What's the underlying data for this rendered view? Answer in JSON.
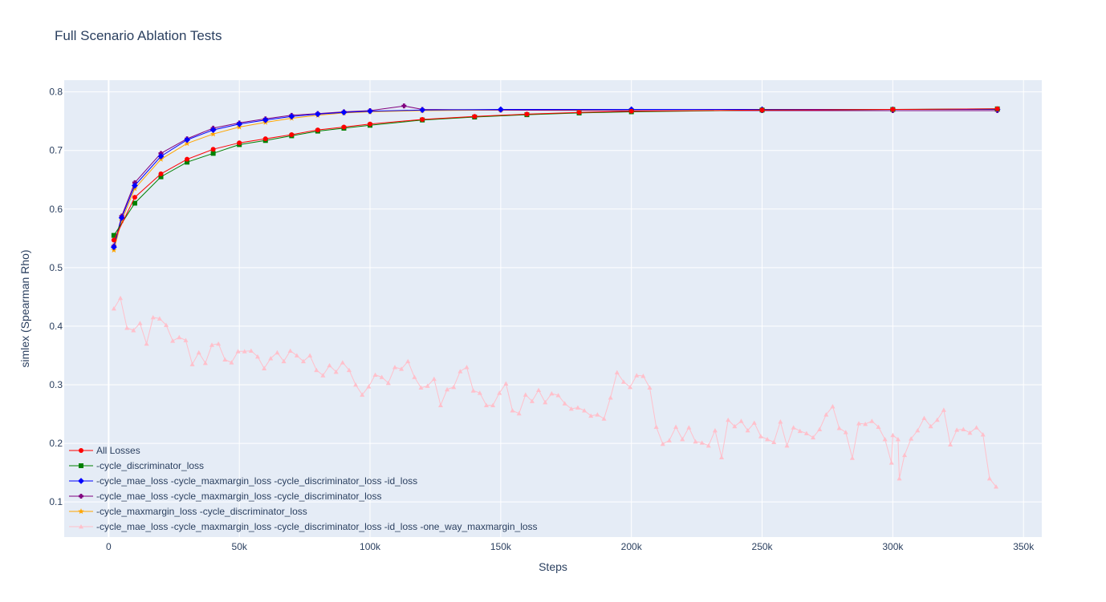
{
  "chart_data": {
    "type": "line",
    "title": "Full Scenario Ablation Tests",
    "xlabel": "Steps",
    "ylabel": "simlex (Spearman Rho)",
    "xlim": [
      -17000,
      357000
    ],
    "ylim": [
      0.04,
      0.82
    ],
    "x_ticks": [
      0,
      50000,
      100000,
      150000,
      200000,
      250000,
      300000,
      350000
    ],
    "x_tick_labels": [
      "0",
      "50k",
      "100k",
      "150k",
      "200k",
      "250k",
      "300k",
      "350k"
    ],
    "y_ticks": [
      0.1,
      0.2,
      0.3,
      0.4,
      0.5,
      0.6,
      0.7,
      0.8
    ],
    "y_tick_labels": [
      "0.1",
      "0.2",
      "0.3",
      "0.4",
      "0.5",
      "0.6",
      "0.7",
      "0.8"
    ],
    "grid": true,
    "legend_position": "bottom-left",
    "background_color": "#e5ecf6",
    "series": [
      {
        "name": "All Losses",
        "color": "#ff0000",
        "marker": "circle",
        "points": [
          [
            2000,
            0.547
          ],
          [
            10000,
            0.62
          ],
          [
            20000,
            0.66
          ],
          [
            30000,
            0.685
          ],
          [
            40000,
            0.702
          ],
          [
            50000,
            0.713
          ],
          [
            60000,
            0.72
          ],
          [
            70000,
            0.727
          ],
          [
            80000,
            0.735
          ],
          [
            90000,
            0.74
          ],
          [
            100000,
            0.745
          ],
          [
            120000,
            0.753
          ],
          [
            140000,
            0.758
          ],
          [
            160000,
            0.762
          ],
          [
            180000,
            0.765
          ],
          [
            200000,
            0.767
          ],
          [
            250000,
            0.769
          ],
          [
            300000,
            0.77
          ],
          [
            340000,
            0.771
          ]
        ]
      },
      {
        "name": "-cycle_discriminator_loss",
        "color": "#008000",
        "marker": "square",
        "points": [
          [
            2000,
            0.555
          ],
          [
            10000,
            0.61
          ],
          [
            20000,
            0.655
          ],
          [
            30000,
            0.68
          ],
          [
            40000,
            0.695
          ],
          [
            50000,
            0.71
          ],
          [
            60000,
            0.717
          ],
          [
            70000,
            0.725
          ],
          [
            80000,
            0.733
          ],
          [
            90000,
            0.738
          ],
          [
            100000,
            0.743
          ],
          [
            120000,
            0.752
          ],
          [
            140000,
            0.757
          ],
          [
            160000,
            0.761
          ],
          [
            180000,
            0.764
          ],
          [
            200000,
            0.766
          ],
          [
            250000,
            0.769
          ],
          [
            300000,
            0.77
          ],
          [
            340000,
            0.771
          ]
        ]
      },
      {
        "name": "-cycle_mae_loss  -cycle_maxmargin_loss  -cycle_discriminator_loss  -id_loss",
        "color": "#0000ff",
        "marker": "diamond",
        "points": [
          [
            2000,
            0.535
          ],
          [
            5000,
            0.585
          ],
          [
            10000,
            0.64
          ],
          [
            20000,
            0.69
          ],
          [
            30000,
            0.718
          ],
          [
            40000,
            0.735
          ],
          [
            50000,
            0.745
          ],
          [
            60000,
            0.752
          ],
          [
            70000,
            0.758
          ],
          [
            80000,
            0.762
          ],
          [
            90000,
            0.765
          ],
          [
            100000,
            0.767
          ],
          [
            120000,
            0.769
          ],
          [
            150000,
            0.77
          ],
          [
            200000,
            0.77
          ],
          [
            250000,
            0.77
          ],
          [
            300000,
            0.77
          ],
          [
            340000,
            0.77
          ]
        ]
      },
      {
        "name": "-cycle_mae_loss  -cycle_maxmargin_loss -cycle_discriminator_loss",
        "color": "#800080",
        "marker": "cross",
        "points": [
          [
            2000,
            0.537
          ],
          [
            5000,
            0.588
          ],
          [
            10000,
            0.645
          ],
          [
            20000,
            0.695
          ],
          [
            30000,
            0.72
          ],
          [
            40000,
            0.738
          ],
          [
            50000,
            0.747
          ],
          [
            60000,
            0.754
          ],
          [
            70000,
            0.76
          ],
          [
            80000,
            0.763
          ],
          [
            90000,
            0.766
          ],
          [
            100000,
            0.768
          ],
          [
            113000,
            0.776
          ],
          [
            120000,
            0.77
          ],
          [
            150000,
            0.769
          ],
          [
            200000,
            0.768
          ],
          [
            250000,
            0.768
          ],
          [
            300000,
            0.768
          ],
          [
            340000,
            0.768
          ]
        ]
      },
      {
        "name": "-cycle_maxmargin_loss -cycle_discriminator_loss",
        "color": "#ffa500",
        "marker": "star",
        "points": [
          [
            2000,
            0.53
          ],
          [
            5000,
            0.58
          ],
          [
            10000,
            0.635
          ],
          [
            20000,
            0.685
          ],
          [
            30000,
            0.712
          ],
          [
            40000,
            0.728
          ],
          [
            50000,
            0.74
          ],
          [
            60000,
            0.748
          ],
          [
            70000,
            0.755
          ],
          [
            80000,
            0.76
          ],
          [
            90000,
            0.764
          ],
          [
            100000,
            0.766
          ],
          [
            120000,
            0.768
          ],
          [
            150000,
            0.769
          ],
          [
            200000,
            0.77
          ],
          [
            250000,
            0.77
          ],
          [
            300000,
            0.77
          ],
          [
            340000,
            0.77
          ]
        ]
      },
      {
        "name": "-cycle_mae_loss -cycle_maxmargin_loss -cycle_discriminator_loss -id_loss -one_way_maxmargin_loss",
        "color": "#ffc0cb",
        "marker": "triangle-up",
        "points": [
          [
            2000,
            0.43
          ],
          [
            4500,
            0.448
          ],
          [
            7000,
            0.397
          ],
          [
            9500,
            0.393
          ],
          [
            12000,
            0.405
          ],
          [
            14500,
            0.37
          ],
          [
            17000,
            0.415
          ],
          [
            19500,
            0.413
          ],
          [
            22000,
            0.402
          ],
          [
            24500,
            0.375
          ],
          [
            27000,
            0.381
          ],
          [
            29500,
            0.376
          ],
          [
            32000,
            0.335
          ],
          [
            34500,
            0.355
          ],
          [
            37000,
            0.337
          ],
          [
            39500,
            0.368
          ],
          [
            42000,
            0.37
          ],
          [
            44500,
            0.343
          ],
          [
            47000,
            0.338
          ],
          [
            49500,
            0.357
          ],
          [
            52000,
            0.357
          ],
          [
            54500,
            0.358
          ],
          [
            57000,
            0.348
          ],
          [
            59500,
            0.328
          ],
          [
            62000,
            0.345
          ],
          [
            64500,
            0.355
          ],
          [
            67000,
            0.34
          ],
          [
            69500,
            0.358
          ],
          [
            72000,
            0.35
          ],
          [
            74500,
            0.34
          ],
          [
            77000,
            0.35
          ],
          [
            79500,
            0.325
          ],
          [
            82000,
            0.316
          ],
          [
            84500,
            0.333
          ],
          [
            87000,
            0.322
          ],
          [
            89500,
            0.338
          ],
          [
            92000,
            0.325
          ],
          [
            94500,
            0.3
          ],
          [
            97000,
            0.283
          ],
          [
            99500,
            0.297
          ],
          [
            102000,
            0.317
          ],
          [
            104500,
            0.313
          ],
          [
            107000,
            0.303
          ],
          [
            109500,
            0.33
          ],
          [
            112000,
            0.327
          ],
          [
            114500,
            0.34
          ],
          [
            117000,
            0.313
          ],
          [
            119500,
            0.295
          ],
          [
            122000,
            0.298
          ],
          [
            124500,
            0.31
          ],
          [
            127000,
            0.265
          ],
          [
            129500,
            0.292
          ],
          [
            132000,
            0.296
          ],
          [
            134500,
            0.323
          ],
          [
            137000,
            0.33
          ],
          [
            139500,
            0.29
          ],
          [
            142000,
            0.286
          ],
          [
            144500,
            0.265
          ],
          [
            147000,
            0.265
          ],
          [
            149500,
            0.286
          ],
          [
            152000,
            0.302
          ],
          [
            154500,
            0.256
          ],
          [
            157000,
            0.251
          ],
          [
            159500,
            0.283
          ],
          [
            162000,
            0.272
          ],
          [
            164500,
            0.291
          ],
          [
            167000,
            0.27
          ],
          [
            169500,
            0.285
          ],
          [
            172000,
            0.282
          ],
          [
            174500,
            0.268
          ],
          [
            177000,
            0.259
          ],
          [
            179500,
            0.261
          ],
          [
            182000,
            0.256
          ],
          [
            184500,
            0.247
          ],
          [
            187000,
            0.249
          ],
          [
            189500,
            0.242
          ],
          [
            192000,
            0.278
          ],
          [
            194500,
            0.321
          ],
          [
            197000,
            0.305
          ],
          [
            199500,
            0.296
          ],
          [
            202000,
            0.316
          ],
          [
            204500,
            0.315
          ],
          [
            207000,
            0.295
          ],
          [
            209500,
            0.228
          ],
          [
            212000,
            0.199
          ],
          [
            214500,
            0.205
          ],
          [
            217000,
            0.228
          ],
          [
            219500,
            0.207
          ],
          [
            222000,
            0.227
          ],
          [
            224500,
            0.203
          ],
          [
            227000,
            0.201
          ],
          [
            229500,
            0.196
          ],
          [
            232000,
            0.222
          ],
          [
            234500,
            0.176
          ],
          [
            237000,
            0.24
          ],
          [
            239500,
            0.229
          ],
          [
            242000,
            0.238
          ],
          [
            244500,
            0.222
          ],
          [
            247000,
            0.235
          ],
          [
            249500,
            0.212
          ],
          [
            252000,
            0.207
          ],
          [
            254500,
            0.202
          ],
          [
            257000,
            0.237
          ],
          [
            259500,
            0.196
          ],
          [
            262000,
            0.227
          ],
          [
            264500,
            0.221
          ],
          [
            267000,
            0.217
          ],
          [
            269500,
            0.21
          ],
          [
            272000,
            0.224
          ],
          [
            274500,
            0.249
          ],
          [
            277000,
            0.263
          ],
          [
            279500,
            0.226
          ],
          [
            282000,
            0.219
          ],
          [
            284500,
            0.175
          ],
          [
            287000,
            0.234
          ],
          [
            289500,
            0.233
          ],
          [
            292000,
            0.238
          ],
          [
            294500,
            0.228
          ],
          [
            297000,
            0.207
          ],
          [
            299500,
            0.167
          ],
          [
            302000,
            0.207
          ],
          [
            304500,
            0.18
          ],
          [
            307000,
            0.208
          ],
          [
            309500,
            0.222
          ],
          [
            312000,
            0.243
          ],
          [
            314500,
            0.229
          ],
          [
            317000,
            0.24
          ],
          [
            319500,
            0.257
          ],
          [
            322000,
            0.198
          ],
          [
            324500,
            0.223
          ],
          [
            327000,
            0.224
          ],
          [
            329500,
            0.218
          ],
          [
            332000,
            0.227
          ],
          [
            334500,
            0.215
          ],
          [
            337000,
            0.14
          ],
          [
            339500,
            0.126
          ],
          [
            300000,
            0.214
          ],
          [
            302500,
            0.14
          ]
        ]
      }
    ]
  }
}
